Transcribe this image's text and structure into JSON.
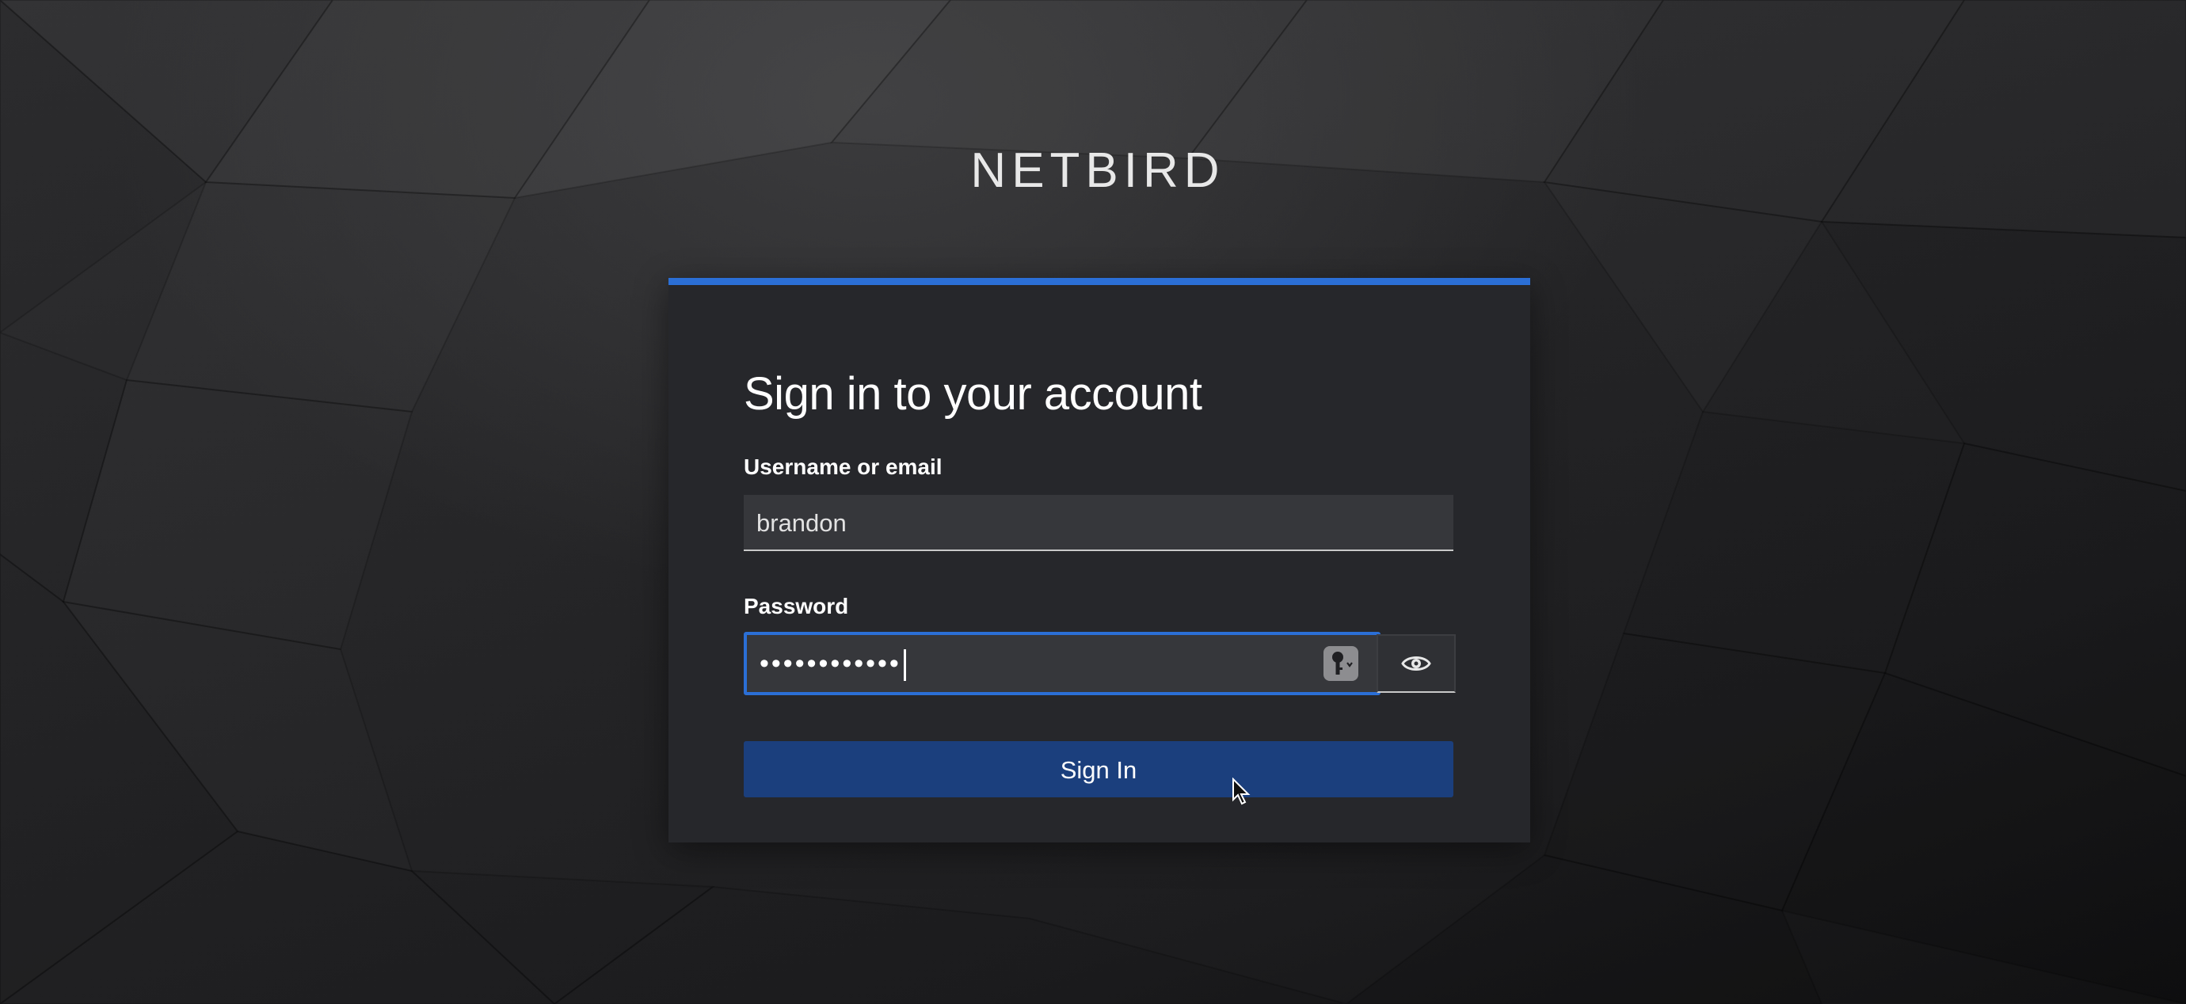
{
  "brand": {
    "name": "NETBIRD"
  },
  "login": {
    "title": "Sign in to your account",
    "username_label": "Username or email",
    "username_value": "brandon",
    "password_label": "Password",
    "password_mask": "••••••••••••",
    "submit_label": "Sign In"
  },
  "icons": {
    "password_manager": "key-icon",
    "show_password": "eye-icon",
    "pointer": "mouse-pointer-icon"
  },
  "colors": {
    "accent": "#2b6fd6",
    "button": "#1b3f7d",
    "card": "#26272b",
    "input": "#36373b"
  }
}
